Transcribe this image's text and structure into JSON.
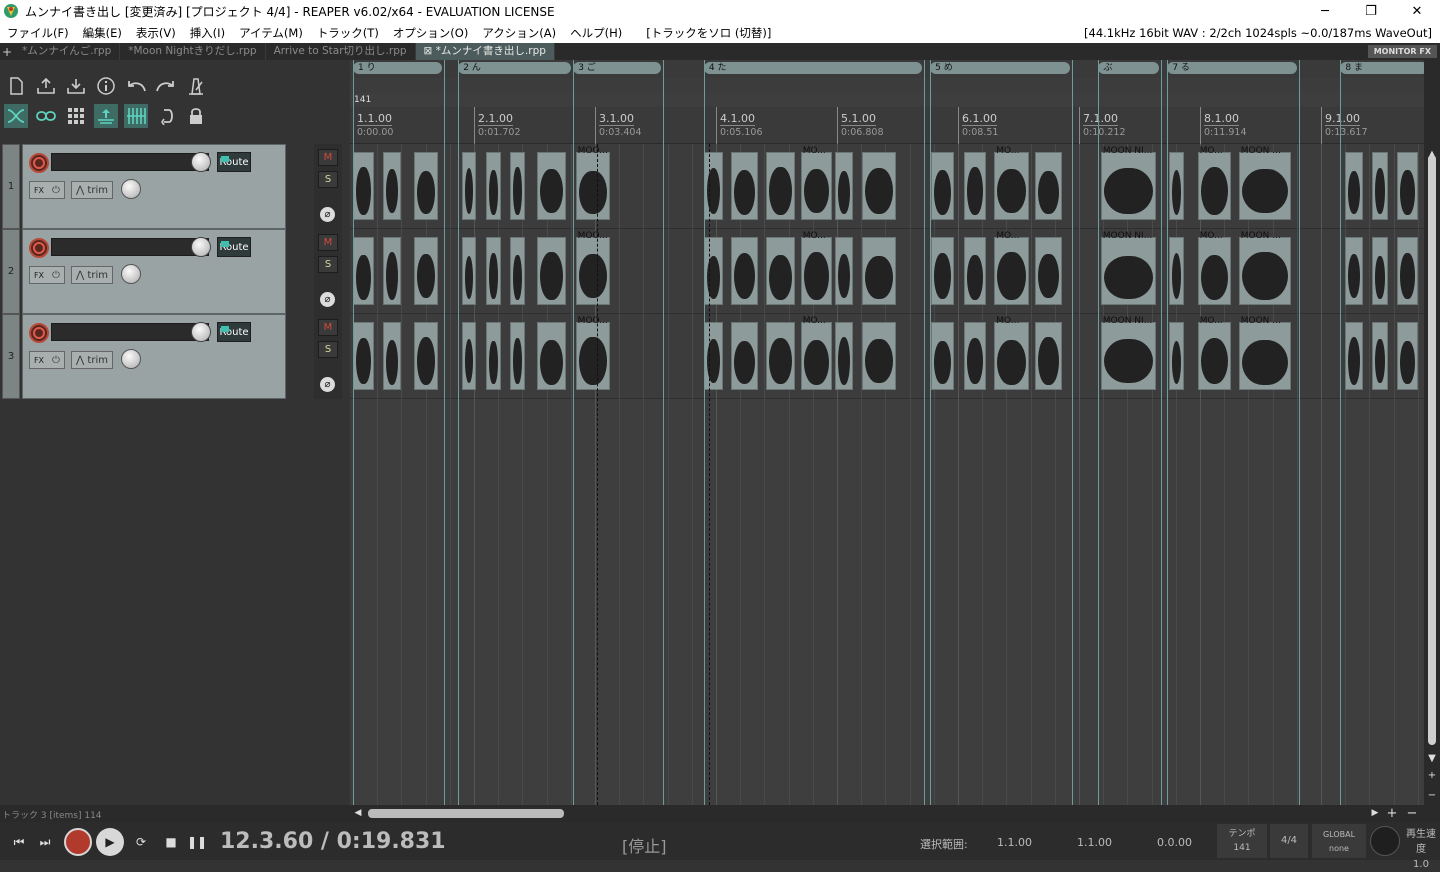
{
  "window": {
    "title": "ムンナイ書き出し [変更済み] [プロジェクト 4/4] - REAPER v6.02/x64 - EVALUATION LICENSE",
    "minimize": "─",
    "maximize": "❐",
    "close": "✕"
  },
  "menu": {
    "items": [
      "ファイル(F)",
      "編集(E)",
      "表示(V)",
      "挿入(I)",
      "アイテム(M)",
      "トラック(T)",
      "オプション(O)",
      "アクション(A)",
      "ヘルプ(H)"
    ],
    "extra": "[トラックをソロ (切替)]",
    "audio_status": "[44.1kHz 16bit WAV : 2/2ch 1024spls ~0.0/187ms WaveOut]"
  },
  "tabs": {
    "add": "+",
    "items": [
      {
        "label": "*ムンナイんご.rpp",
        "active": false
      },
      {
        "label": "*Moon Nightきりだし.rpp",
        "active": false
      },
      {
        "label": "Arrive to Star切り出し.rpp",
        "active": false
      },
      {
        "label": "⊠ *ムンナイ書き出し.rpp",
        "active": true
      }
    ],
    "monitor_fx": "MONITOR FX"
  },
  "tracks": [
    {
      "number": "1",
      "route": "Route",
      "fx": "FX",
      "trim": "trim",
      "mute": "M",
      "solo": "S",
      "phase": "⌀"
    },
    {
      "number": "2",
      "route": "Route",
      "fx": "FX",
      "trim": "trim",
      "mute": "M",
      "solo": "S",
      "phase": "⌀"
    },
    {
      "number": "3",
      "route": "Route",
      "fx": "FX",
      "trim": "trim",
      "mute": "M",
      "solo": "S",
      "phase": "⌀"
    }
  ],
  "regions": [
    {
      "label": "1 り",
      "start_beat": 0,
      "end_beat": 3.75
    },
    {
      "label": "2 ん",
      "start_beat": 4.35,
      "end_beat": 9.1
    },
    {
      "label": "3 ご",
      "start_beat": 9.1,
      "end_beat": 12.8
    },
    {
      "label": "4 た",
      "start_beat": 14.5,
      "end_beat": 23.6
    },
    {
      "label": "5 め",
      "start_beat": 23.85,
      "end_beat": 29.7
    },
    {
      "label": "ぶ",
      "start_beat": 30.8,
      "end_beat": 33.4
    },
    {
      "label": "7 る",
      "start_beat": 33.65,
      "end_beat": 39.1
    },
    {
      "label": "8 ま",
      "start_beat": 40.8,
      "end_beat": 44.5
    }
  ],
  "tempo_value": "141",
  "ruler": [
    {
      "bar": "1.1.00",
      "time": "0:00.00"
    },
    {
      "bar": "2.1.00",
      "time": "0:01.702"
    },
    {
      "bar": "3.1.00",
      "time": "0:03.404"
    },
    {
      "bar": "4.1.00",
      "time": "0:05.106"
    },
    {
      "bar": "5.1.00",
      "time": "0:06.808"
    },
    {
      "bar": "6.1.00",
      "time": "0:08.51"
    },
    {
      "bar": "7.1.00",
      "time": "0:10.212"
    },
    {
      "bar": "8.1.00",
      "time": "0:11.914"
    },
    {
      "bar": "9.1.00",
      "time": "0:13.617"
    }
  ],
  "items": [
    {
      "start_beat": 0,
      "end_beat": 0.85,
      "label": ""
    },
    {
      "start_beat": 1.25,
      "end_beat": 2.0,
      "label": ""
    },
    {
      "start_beat": 2.5,
      "end_beat": 3.5,
      "label": ""
    },
    {
      "start_beat": 4.5,
      "end_beat": 5.1,
      "label": ""
    },
    {
      "start_beat": 5.5,
      "end_beat": 6.1,
      "label": ""
    },
    {
      "start_beat": 6.5,
      "end_beat": 7.1,
      "label": ""
    },
    {
      "start_beat": 7.6,
      "end_beat": 8.8,
      "label": ""
    },
    {
      "start_beat": 9.2,
      "end_beat": 10.6,
      "label": "MOO..."
    },
    {
      "start_beat": 14.5,
      "end_beat": 15.3,
      "label": ""
    },
    {
      "start_beat": 15.6,
      "end_beat": 16.75,
      "label": ""
    },
    {
      "start_beat": 17.05,
      "end_beat": 18.25,
      "label": ""
    },
    {
      "start_beat": 18.5,
      "end_beat": 19.8,
      "label": "MO..."
    },
    {
      "start_beat": 19.9,
      "end_beat": 20.65,
      "label": ""
    },
    {
      "start_beat": 21.05,
      "end_beat": 22.45,
      "label": ""
    },
    {
      "start_beat": 23.9,
      "end_beat": 24.85,
      "label": ""
    },
    {
      "start_beat": 25.25,
      "end_beat": 26.15,
      "label": ""
    },
    {
      "start_beat": 26.5,
      "end_beat": 27.95,
      "label": "MO..."
    },
    {
      "start_beat": 28.2,
      "end_beat": 29.3,
      "label": ""
    },
    {
      "start_beat": 30.9,
      "end_beat": 33.2,
      "label": "MOON NI..."
    },
    {
      "start_beat": 33.7,
      "end_beat": 34.35,
      "label": ""
    },
    {
      "start_beat": 34.9,
      "end_beat": 36.3,
      "label": "MO..."
    },
    {
      "start_beat": 36.6,
      "end_beat": 38.75,
      "label": "MOON ..."
    },
    {
      "start_beat": 41.0,
      "end_beat": 41.75,
      "label": ""
    },
    {
      "start_beat": 42.1,
      "end_beat": 42.75,
      "label": ""
    },
    {
      "start_beat": 43.15,
      "end_beat": 44.0,
      "label": ""
    }
  ],
  "status": {
    "track_items": "トラック 3 [items] 114"
  },
  "transport": {
    "position": "12.3.60 / 0:19.831",
    "state": "[停止]",
    "selection_label": "選択範囲:",
    "sel_start": "1.1.00",
    "sel_end": "1.1.00",
    "sel_length": "0.0.00",
    "tempo_label": "テンポ",
    "tempo": "141",
    "time_sig": "4/4",
    "global_label": "GLOBAL",
    "global_value": "none",
    "rate_label": "再生速度",
    "rate_value": "1.0"
  }
}
